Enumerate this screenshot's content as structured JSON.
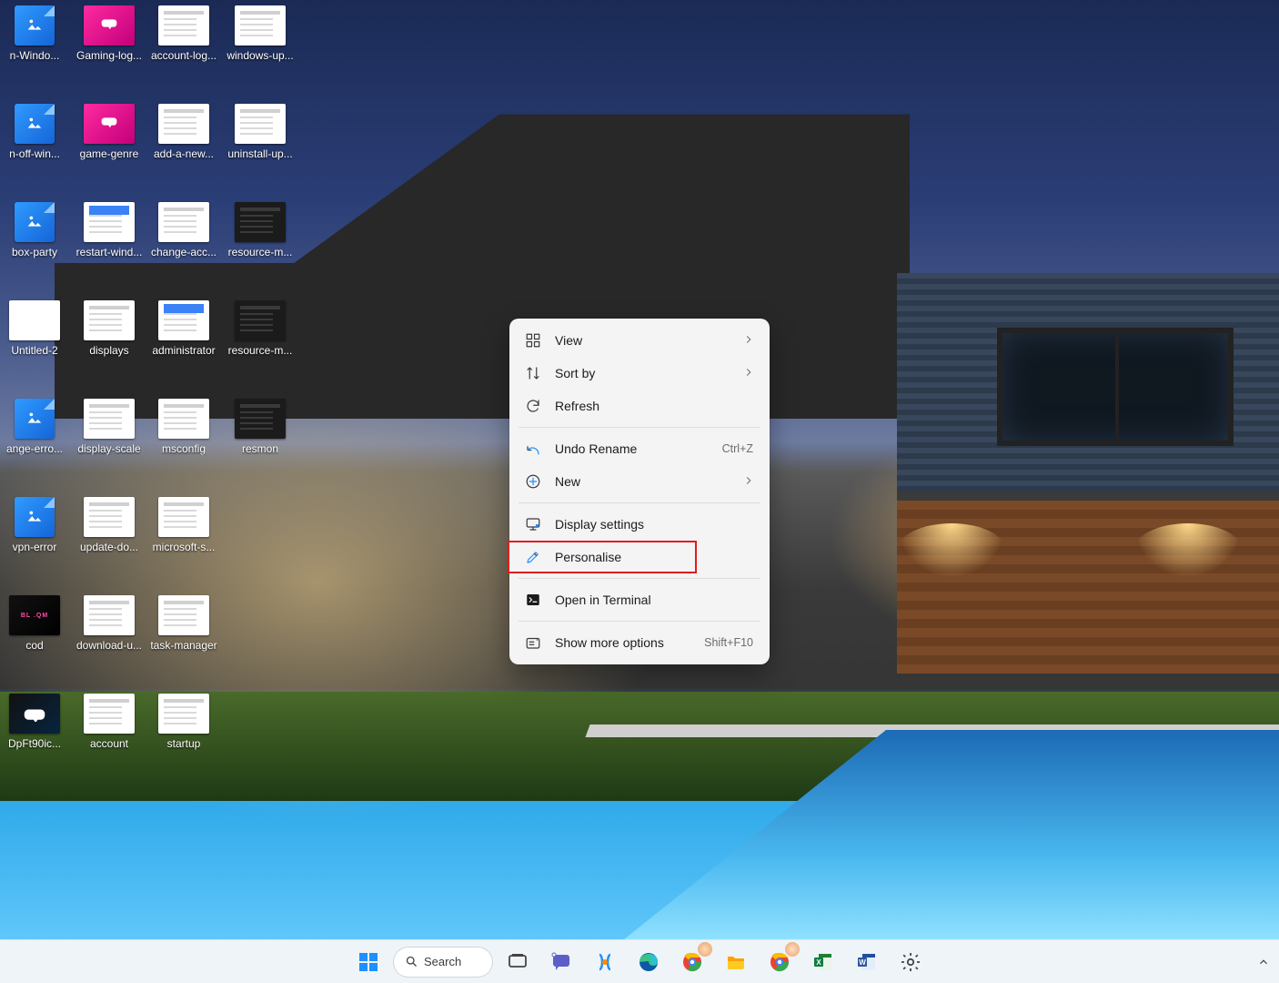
{
  "desktop": {
    "icons": [
      [
        {
          "label": "n-Windo...",
          "kind": "image"
        },
        {
          "label": "n-off-win...",
          "kind": "image"
        },
        {
          "label": "box-party",
          "kind": "image"
        },
        {
          "label": "Untitled-2",
          "kind": "doc-plain"
        },
        {
          "label": "ange-erro...",
          "kind": "image"
        },
        {
          "label": "vpn-error",
          "kind": "image"
        },
        {
          "label": "cod",
          "kind": "cod"
        },
        {
          "label": "DpFt90ic...",
          "kind": "dpft"
        }
      ],
      [
        {
          "label": "Gaming-log...",
          "kind": "gaming"
        },
        {
          "label": "game-genre",
          "kind": "gaming"
        },
        {
          "label": "restart-wind...",
          "kind": "doc-blue"
        },
        {
          "label": "displays",
          "kind": "doc"
        },
        {
          "label": "display-scale",
          "kind": "doc"
        },
        {
          "label": "update-do...",
          "kind": "doc"
        },
        {
          "label": "download-u...",
          "kind": "doc"
        },
        {
          "label": "account",
          "kind": "doc"
        }
      ],
      [
        {
          "label": "account-log...",
          "kind": "doc"
        },
        {
          "label": "add-a-new...",
          "kind": "doc"
        },
        {
          "label": "change-acc...",
          "kind": "doc"
        },
        {
          "label": "administrator",
          "kind": "doc-blue"
        },
        {
          "label": "msconfig",
          "kind": "doc"
        },
        {
          "label": "microsoft-s...",
          "kind": "doc"
        },
        {
          "label": "task-manager",
          "kind": "doc"
        },
        {
          "label": "startup",
          "kind": "doc"
        }
      ],
      [
        {
          "label": "windows-up...",
          "kind": "doc"
        },
        {
          "label": "uninstall-up...",
          "kind": "doc"
        },
        {
          "label": "resource-m...",
          "kind": "doc-dark"
        },
        {
          "label": "resource-m...",
          "kind": "doc-dark"
        },
        {
          "label": "resmon",
          "kind": "doc-dark"
        }
      ]
    ]
  },
  "context_menu": {
    "items": [
      {
        "icon": "view",
        "label": "View",
        "chevron": true
      },
      {
        "icon": "sort",
        "label": "Sort by",
        "chevron": true
      },
      {
        "icon": "refresh",
        "label": "Refresh"
      },
      {
        "sep": true
      },
      {
        "icon": "undo",
        "label": "Undo Rename",
        "shortcut": "Ctrl+Z"
      },
      {
        "icon": "new",
        "label": "New",
        "chevron": true
      },
      {
        "sep": true
      },
      {
        "icon": "display",
        "label": "Display settings"
      },
      {
        "icon": "personalise",
        "label": "Personalise"
      },
      {
        "sep": true
      },
      {
        "icon": "terminal",
        "label": "Open in Terminal"
      },
      {
        "sep": true
      },
      {
        "icon": "more",
        "label": "Show more options",
        "shortcut": "Shift+F10"
      }
    ],
    "highlight_index": 8
  },
  "taskbar": {
    "search_label": "Search",
    "apps": [
      "start",
      "search",
      "taskview",
      "chat",
      "copilot",
      "edge",
      "chrome",
      "explorer",
      "chrome2",
      "excel",
      "word",
      "settings"
    ]
  }
}
